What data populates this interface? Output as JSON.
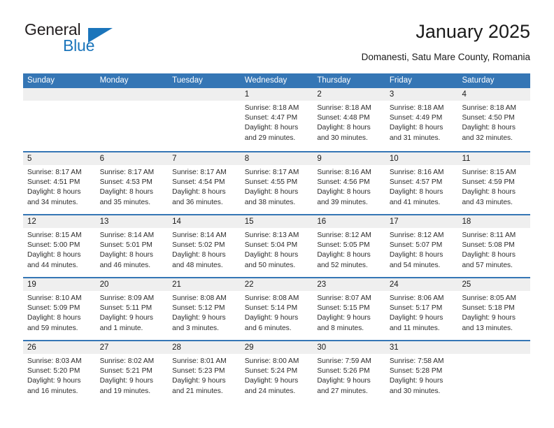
{
  "brand": {
    "name_part1": "General",
    "name_part2": "Blue",
    "accent_color": "#1b75bb",
    "triangle_icon": "triangle-icon"
  },
  "header": {
    "title": "January 2025",
    "subtitle": "Domanesti, Satu Mare County, Romania"
  },
  "calendar": {
    "header_color": "#3576b5",
    "day_band_color": "#efefef",
    "weekdays": [
      "Sunday",
      "Monday",
      "Tuesday",
      "Wednesday",
      "Thursday",
      "Friday",
      "Saturday"
    ],
    "weeks": [
      [
        {
          "empty": true
        },
        {
          "empty": true
        },
        {
          "empty": true
        },
        {
          "day": "1",
          "sunrise": "Sunrise: 8:18 AM",
          "sunset": "Sunset: 4:47 PM",
          "daylight_line1": "Daylight: 8 hours",
          "daylight_line2": "and 29 minutes."
        },
        {
          "day": "2",
          "sunrise": "Sunrise: 8:18 AM",
          "sunset": "Sunset: 4:48 PM",
          "daylight_line1": "Daylight: 8 hours",
          "daylight_line2": "and 30 minutes."
        },
        {
          "day": "3",
          "sunrise": "Sunrise: 8:18 AM",
          "sunset": "Sunset: 4:49 PM",
          "daylight_line1": "Daylight: 8 hours",
          "daylight_line2": "and 31 minutes."
        },
        {
          "day": "4",
          "sunrise": "Sunrise: 8:18 AM",
          "sunset": "Sunset: 4:50 PM",
          "daylight_line1": "Daylight: 8 hours",
          "daylight_line2": "and 32 minutes."
        }
      ],
      [
        {
          "day": "5",
          "sunrise": "Sunrise: 8:17 AM",
          "sunset": "Sunset: 4:51 PM",
          "daylight_line1": "Daylight: 8 hours",
          "daylight_line2": "and 34 minutes."
        },
        {
          "day": "6",
          "sunrise": "Sunrise: 8:17 AM",
          "sunset": "Sunset: 4:53 PM",
          "daylight_line1": "Daylight: 8 hours",
          "daylight_line2": "and 35 minutes."
        },
        {
          "day": "7",
          "sunrise": "Sunrise: 8:17 AM",
          "sunset": "Sunset: 4:54 PM",
          "daylight_line1": "Daylight: 8 hours",
          "daylight_line2": "and 36 minutes."
        },
        {
          "day": "8",
          "sunrise": "Sunrise: 8:17 AM",
          "sunset": "Sunset: 4:55 PM",
          "daylight_line1": "Daylight: 8 hours",
          "daylight_line2": "and 38 minutes."
        },
        {
          "day": "9",
          "sunrise": "Sunrise: 8:16 AM",
          "sunset": "Sunset: 4:56 PM",
          "daylight_line1": "Daylight: 8 hours",
          "daylight_line2": "and 39 minutes."
        },
        {
          "day": "10",
          "sunrise": "Sunrise: 8:16 AM",
          "sunset": "Sunset: 4:57 PM",
          "daylight_line1": "Daylight: 8 hours",
          "daylight_line2": "and 41 minutes."
        },
        {
          "day": "11",
          "sunrise": "Sunrise: 8:15 AM",
          "sunset": "Sunset: 4:59 PM",
          "daylight_line1": "Daylight: 8 hours",
          "daylight_line2": "and 43 minutes."
        }
      ],
      [
        {
          "day": "12",
          "sunrise": "Sunrise: 8:15 AM",
          "sunset": "Sunset: 5:00 PM",
          "daylight_line1": "Daylight: 8 hours",
          "daylight_line2": "and 44 minutes."
        },
        {
          "day": "13",
          "sunrise": "Sunrise: 8:14 AM",
          "sunset": "Sunset: 5:01 PM",
          "daylight_line1": "Daylight: 8 hours",
          "daylight_line2": "and 46 minutes."
        },
        {
          "day": "14",
          "sunrise": "Sunrise: 8:14 AM",
          "sunset": "Sunset: 5:02 PM",
          "daylight_line1": "Daylight: 8 hours",
          "daylight_line2": "and 48 minutes."
        },
        {
          "day": "15",
          "sunrise": "Sunrise: 8:13 AM",
          "sunset": "Sunset: 5:04 PM",
          "daylight_line1": "Daylight: 8 hours",
          "daylight_line2": "and 50 minutes."
        },
        {
          "day": "16",
          "sunrise": "Sunrise: 8:12 AM",
          "sunset": "Sunset: 5:05 PM",
          "daylight_line1": "Daylight: 8 hours",
          "daylight_line2": "and 52 minutes."
        },
        {
          "day": "17",
          "sunrise": "Sunrise: 8:12 AM",
          "sunset": "Sunset: 5:07 PM",
          "daylight_line1": "Daylight: 8 hours",
          "daylight_line2": "and 54 minutes."
        },
        {
          "day": "18",
          "sunrise": "Sunrise: 8:11 AM",
          "sunset": "Sunset: 5:08 PM",
          "daylight_line1": "Daylight: 8 hours",
          "daylight_line2": "and 57 minutes."
        }
      ],
      [
        {
          "day": "19",
          "sunrise": "Sunrise: 8:10 AM",
          "sunset": "Sunset: 5:09 PM",
          "daylight_line1": "Daylight: 8 hours",
          "daylight_line2": "and 59 minutes."
        },
        {
          "day": "20",
          "sunrise": "Sunrise: 8:09 AM",
          "sunset": "Sunset: 5:11 PM",
          "daylight_line1": "Daylight: 9 hours",
          "daylight_line2": "and 1 minute."
        },
        {
          "day": "21",
          "sunrise": "Sunrise: 8:08 AM",
          "sunset": "Sunset: 5:12 PM",
          "daylight_line1": "Daylight: 9 hours",
          "daylight_line2": "and 3 minutes."
        },
        {
          "day": "22",
          "sunrise": "Sunrise: 8:08 AM",
          "sunset": "Sunset: 5:14 PM",
          "daylight_line1": "Daylight: 9 hours",
          "daylight_line2": "and 6 minutes."
        },
        {
          "day": "23",
          "sunrise": "Sunrise: 8:07 AM",
          "sunset": "Sunset: 5:15 PM",
          "daylight_line1": "Daylight: 9 hours",
          "daylight_line2": "and 8 minutes."
        },
        {
          "day": "24",
          "sunrise": "Sunrise: 8:06 AM",
          "sunset": "Sunset: 5:17 PM",
          "daylight_line1": "Daylight: 9 hours",
          "daylight_line2": "and 11 minutes."
        },
        {
          "day": "25",
          "sunrise": "Sunrise: 8:05 AM",
          "sunset": "Sunset: 5:18 PM",
          "daylight_line1": "Daylight: 9 hours",
          "daylight_line2": "and 13 minutes."
        }
      ],
      [
        {
          "day": "26",
          "sunrise": "Sunrise: 8:03 AM",
          "sunset": "Sunset: 5:20 PM",
          "daylight_line1": "Daylight: 9 hours",
          "daylight_line2": "and 16 minutes."
        },
        {
          "day": "27",
          "sunrise": "Sunrise: 8:02 AM",
          "sunset": "Sunset: 5:21 PM",
          "daylight_line1": "Daylight: 9 hours",
          "daylight_line2": "and 19 minutes."
        },
        {
          "day": "28",
          "sunrise": "Sunrise: 8:01 AM",
          "sunset": "Sunset: 5:23 PM",
          "daylight_line1": "Daylight: 9 hours",
          "daylight_line2": "and 21 minutes."
        },
        {
          "day": "29",
          "sunrise": "Sunrise: 8:00 AM",
          "sunset": "Sunset: 5:24 PM",
          "daylight_line1": "Daylight: 9 hours",
          "daylight_line2": "and 24 minutes."
        },
        {
          "day": "30",
          "sunrise": "Sunrise: 7:59 AM",
          "sunset": "Sunset: 5:26 PM",
          "daylight_line1": "Daylight: 9 hours",
          "daylight_line2": "and 27 minutes."
        },
        {
          "day": "31",
          "sunrise": "Sunrise: 7:58 AM",
          "sunset": "Sunset: 5:28 PM",
          "daylight_line1": "Daylight: 9 hours",
          "daylight_line2": "and 30 minutes."
        },
        {
          "empty": true
        }
      ]
    ]
  }
}
